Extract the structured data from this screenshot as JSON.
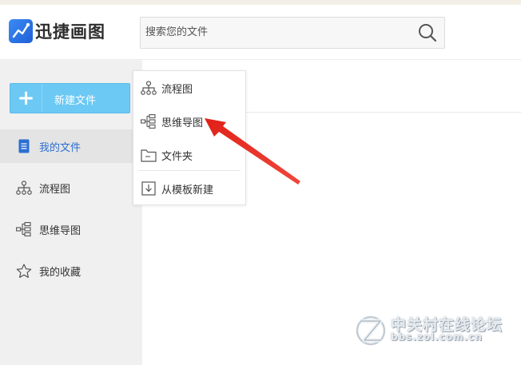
{
  "app": {
    "name": "迅捷画图"
  },
  "search": {
    "placeholder": "搜索您的文件"
  },
  "sidebar": {
    "new_button_label": "新建文件",
    "items": [
      {
        "label": "我的文件",
        "icon": "document-icon",
        "active": true
      },
      {
        "label": "流程图",
        "icon": "flowchart-icon",
        "active": false
      },
      {
        "label": "思维导图",
        "icon": "mindmap-icon",
        "active": false
      },
      {
        "label": "我的收藏",
        "icon": "star-icon",
        "active": false
      }
    ]
  },
  "new_menu": {
    "items": [
      {
        "label": "流程图",
        "icon": "flowchart-icon"
      },
      {
        "label": "思维导图",
        "icon": "mindmap-icon"
      },
      {
        "label": "文件夹",
        "icon": "folder-icon"
      },
      {
        "label": "从模板新建",
        "icon": "template-icon"
      }
    ]
  },
  "annotation": {
    "arrow_color": "#e8332a",
    "points_to": "思维导图"
  },
  "watermark": {
    "title": "中关村在线论坛",
    "url": "bbs.zol.com.cn"
  },
  "colors": {
    "accent_blue": "#2b6fd2",
    "new_button": "#6cc9f4",
    "sidebar_bg": "#f0f0f0"
  }
}
